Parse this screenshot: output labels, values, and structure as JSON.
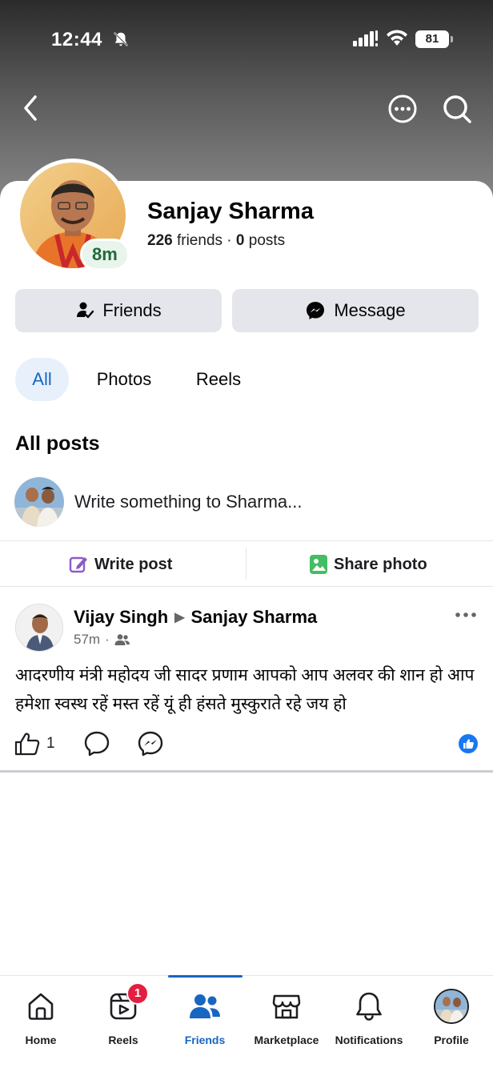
{
  "status_bar": {
    "time": "12:44",
    "battery": "81"
  },
  "profile": {
    "name": "Sanjay Sharma",
    "friends_count": "226",
    "friends_label": "friends",
    "separator": "·",
    "posts_count": "0",
    "posts_label": "posts",
    "active_badge": "8m"
  },
  "actions": {
    "friends_label": "Friends",
    "message_label": "Message"
  },
  "filter_tabs": [
    {
      "label": "All"
    },
    {
      "label": "Photos"
    },
    {
      "label": "Reels"
    }
  ],
  "section_title": "All posts",
  "composer": {
    "placeholder": "Write something to Sharma...",
    "write_post_label": "Write post",
    "share_photo_label": "Share photo"
  },
  "post": {
    "author": "Vijay Singh",
    "target": "Sanjay Sharma",
    "time": "57m",
    "meta_separator": "·",
    "text": "आदरणीय मंत्री महोदय जी सादर प्रणाम आपको आप अलवर की शान हो आप हमेशा स्वस्थ रहें मस्त रहें यूं ही हंसते मुस्कुराते रहे जय हो",
    "like_count": "1"
  },
  "bottom_nav": {
    "items": [
      {
        "label": "Home",
        "icon": "home-icon"
      },
      {
        "label": "Reels",
        "icon": "reels-icon",
        "badge": "1"
      },
      {
        "label": "Friends",
        "icon": "friends-icon",
        "active": true
      },
      {
        "label": "Marketplace",
        "icon": "marketplace-icon"
      },
      {
        "label": "Notifications",
        "icon": "bell-icon"
      },
      {
        "label": "Profile",
        "icon": "profile-avatar"
      }
    ]
  },
  "colors": {
    "accent": "#1766c2",
    "button_bg": "#e4e6eb",
    "tab_active_bg": "#e7f0fb",
    "badge_red": "#e41e3f",
    "online_green": "#1f6b3a"
  }
}
